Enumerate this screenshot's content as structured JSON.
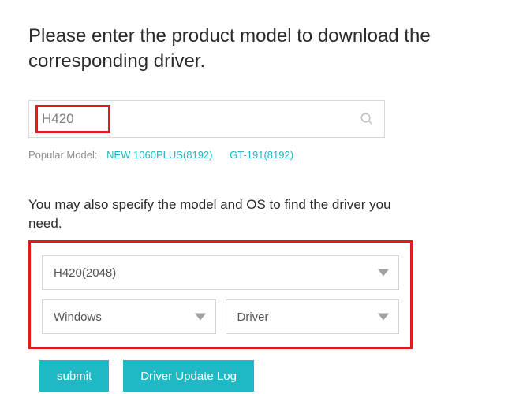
{
  "heading": "Please enter the product model to download the corresponding driver.",
  "search": {
    "value": "H420"
  },
  "popular": {
    "label": "Popular Model:",
    "links": [
      {
        "label": "NEW 1060PLUS(8192)"
      },
      {
        "label": "GT-191(8192)"
      }
    ]
  },
  "specify_text": "You may also specify the model and OS to find the driver you need.",
  "selects": {
    "model": "H420(2048)",
    "os": "Windows",
    "type": "Driver"
  },
  "buttons": {
    "submit": "submit",
    "log": "Driver Update Log"
  }
}
